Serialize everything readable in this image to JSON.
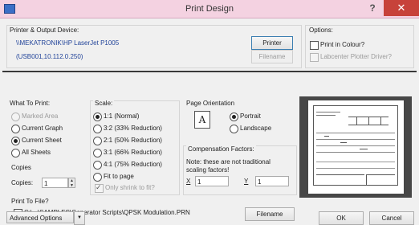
{
  "window": {
    "title": "Print Design",
    "help_glyph": "?",
    "close_glyph": "✕"
  },
  "printer": {
    "group_label": "Printer & Output Device:",
    "device_name": "\\\\MEKATRONIK\\HP LaserJet P1005",
    "device_address": "(USB001,10.112.0.250)",
    "printer_button": "Printer",
    "filename_button": "Filename"
  },
  "options": {
    "group_label": "Options:",
    "print_in_colour": "Print in Colour?",
    "labcenter_plotter": "Labcenter Plotter Driver?"
  },
  "what_to_print": {
    "group_label": "What To Print:",
    "items": [
      "Marked Area",
      "Current Graph",
      "Current Sheet",
      "All Sheets"
    ],
    "selected": "Current Sheet"
  },
  "scale": {
    "group_label": "Scale:",
    "items": [
      "1:1 (Normal)",
      "3:2 (33% Reduction)",
      "2:1 (50% Reduction)",
      "3:1 (66% Reduction)",
      "4:1 (75% Reduction)",
      "Fit to page"
    ],
    "selected": "1:1 (Normal)",
    "only_shrink": "Only shrink to fit?"
  },
  "copies": {
    "group_label": "Copies",
    "label": "Copies:",
    "value": "1"
  },
  "orientation": {
    "group_label": "Page Orientation",
    "icon_letter": "A",
    "portrait": "Portrait",
    "landscape": "Landscape",
    "selected": "Portrait"
  },
  "compensation": {
    "group_label": "Compensation Factors:",
    "note": "Note: these are not traditional scaling factors!",
    "x_label": "X",
    "x_value": "1",
    "y_label": "Y",
    "y_value": "1"
  },
  "print_to_file": {
    "group_label": "Print To File?",
    "path": "C:\\...\\SAMPLES\\Generator Scripts\\QPSK Modulation.PRN",
    "filename_button": "Filename"
  },
  "footer": {
    "advanced_options": "Advanced Options",
    "ok": "OK",
    "cancel": "Cancel"
  }
}
